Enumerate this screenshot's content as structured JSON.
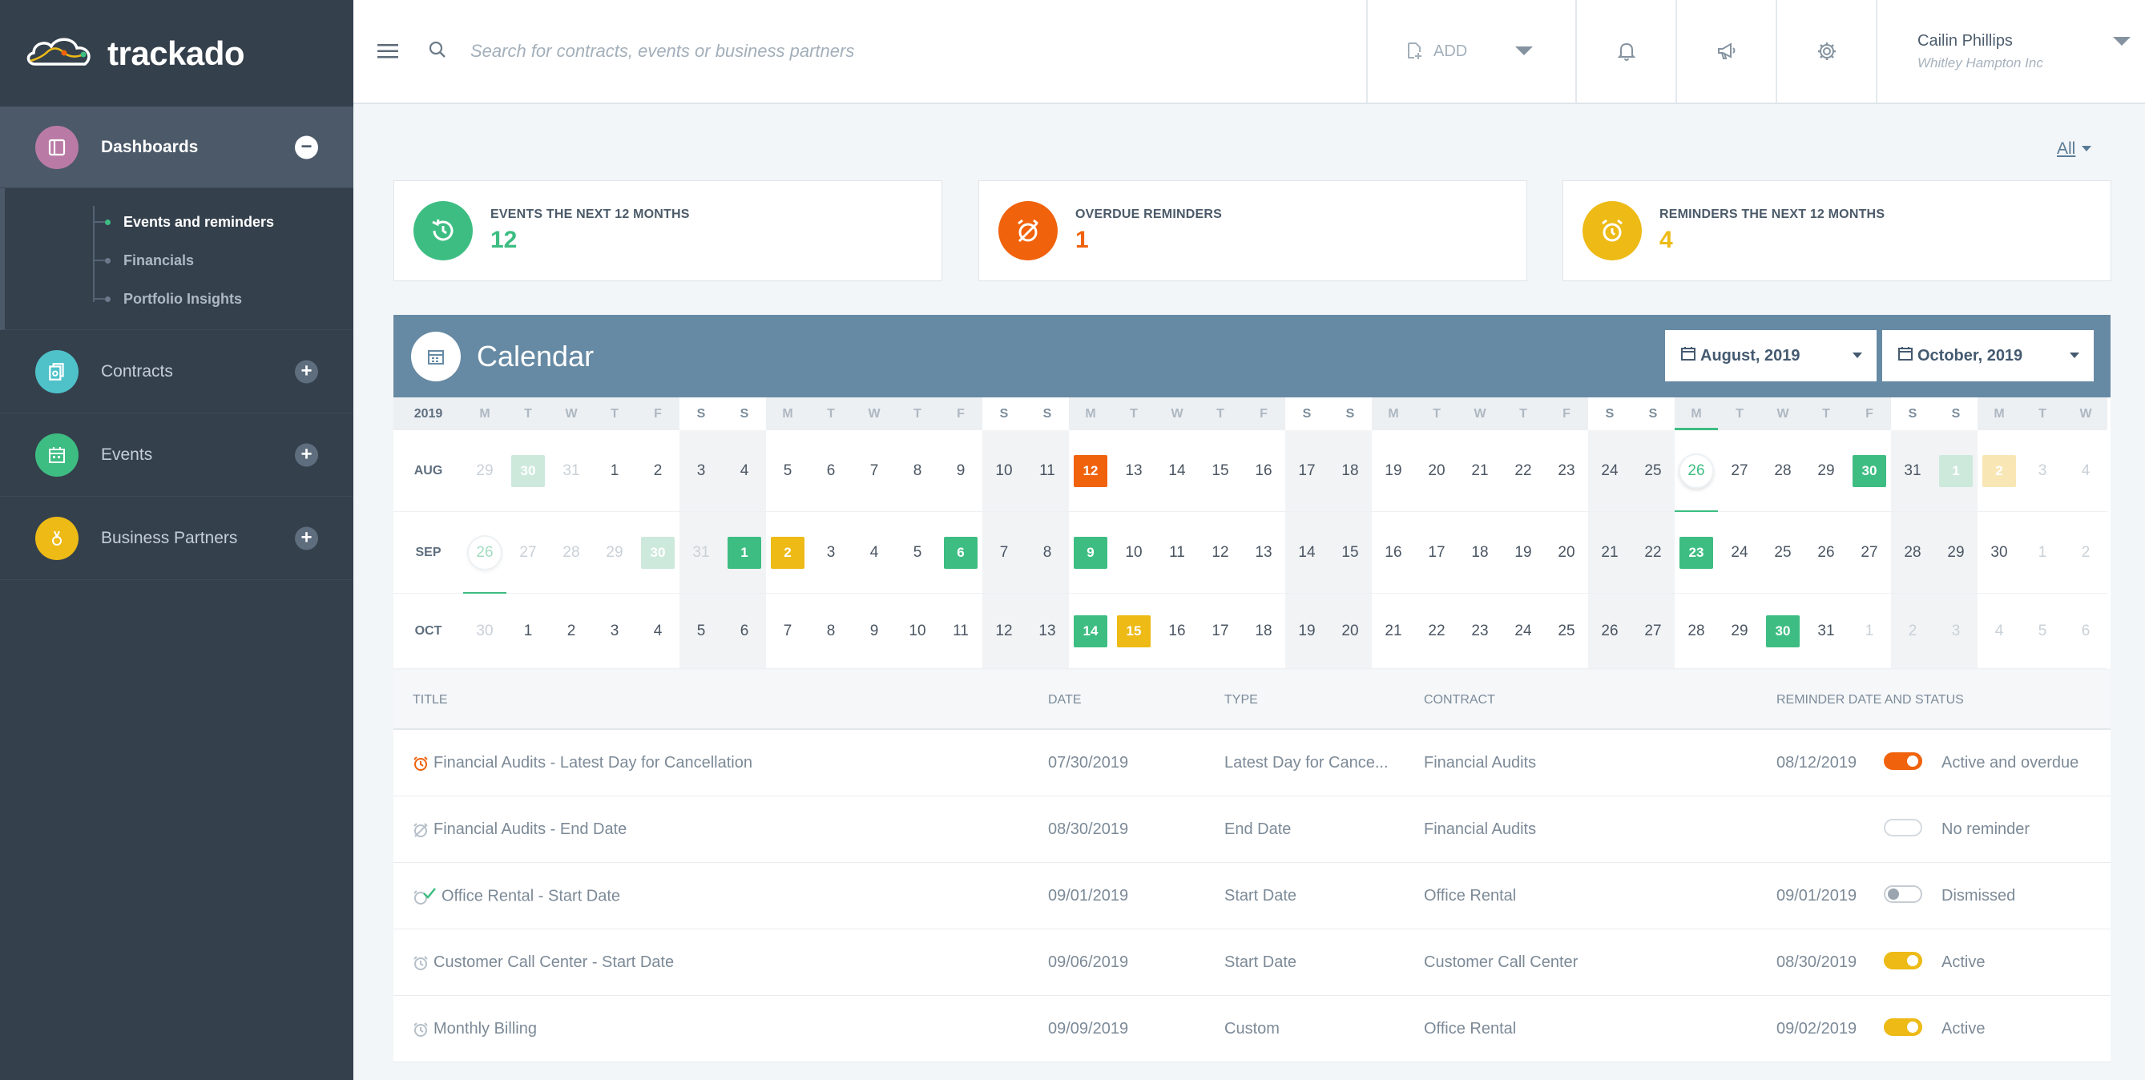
{
  "brand": {
    "name": "trackado"
  },
  "sidebar": {
    "items": [
      {
        "label": "Dashboards",
        "icon": "dashboard-icon",
        "color": "#b97ba5",
        "toggle": "−"
      },
      {
        "label": "Contracts",
        "icon": "contracts-icon",
        "color": "#4fc1c9",
        "toggle": "+"
      },
      {
        "label": "Events",
        "icon": "events-icon",
        "color": "#3dbd82",
        "toggle": "+"
      },
      {
        "label": "Business Partners",
        "icon": "partners-icon",
        "color": "#edba16",
        "toggle": "+"
      }
    ],
    "subitems": [
      "Events and reminders",
      "Financials",
      "Portfolio Insights"
    ]
  },
  "topbar": {
    "search_placeholder": "Search for contracts, events or business partners",
    "add_label": "ADD",
    "user_name": "Cailin Phillips",
    "user_org": "Whitley Hampton Inc"
  },
  "filter": {
    "label": "All"
  },
  "stats": [
    {
      "title": "EVENTS THE NEXT 12 MONTHS",
      "value": "12",
      "color": "#3dbd82",
      "icon": "history-icon"
    },
    {
      "title": "OVERDUE REMINDERS",
      "value": "1",
      "color": "#f0620c",
      "icon": "alarm-off-icon"
    },
    {
      "title": "REMINDERS THE NEXT 12 MONTHS",
      "value": "4",
      "color": "#edba16",
      "icon": "alarm-clock-icon"
    }
  ],
  "calendar": {
    "title": "Calendar",
    "from": "August, 2019",
    "to": "October, 2019",
    "year": "2019",
    "weekdays": [
      "M",
      "T",
      "W",
      "T",
      "F",
      "S",
      "S",
      "M",
      "T",
      "W",
      "T",
      "F",
      "S",
      "S",
      "M",
      "T",
      "W",
      "T",
      "F",
      "S",
      "S",
      "M",
      "T",
      "W",
      "T",
      "F",
      "S",
      "S",
      "M",
      "T",
      "W",
      "T",
      "F",
      "S",
      "S",
      "M",
      "T",
      "W"
    ],
    "rows": [
      {
        "month": "AUG",
        "days": [
          "29",
          "30",
          "31",
          "1",
          "2",
          "3",
          "4",
          "5",
          "6",
          "7",
          "8",
          "9",
          "10",
          "11",
          "12",
          "13",
          "14",
          "15",
          "16",
          "17",
          "18",
          "19",
          "20",
          "21",
          "22",
          "23",
          "24",
          "25",
          "26",
          "27",
          "28",
          "29",
          "30",
          "31",
          "1",
          "2",
          "3",
          "4"
        ]
      },
      {
        "month": "SEP",
        "days": [
          "26",
          "27",
          "28",
          "29",
          "30",
          "31",
          "1",
          "2",
          "3",
          "4",
          "5",
          "6",
          "7",
          "8",
          "9",
          "10",
          "11",
          "12",
          "13",
          "14",
          "15",
          "16",
          "17",
          "18",
          "19",
          "20",
          "21",
          "22",
          "23",
          "24",
          "25",
          "26",
          "27",
          "28",
          "29",
          "30",
          "1",
          "2"
        ]
      },
      {
        "month": "OCT",
        "days": [
          "30",
          "1",
          "2",
          "3",
          "4",
          "5",
          "6",
          "7",
          "8",
          "9",
          "10",
          "11",
          "12",
          "13",
          "14",
          "15",
          "16",
          "17",
          "18",
          "19",
          "20",
          "21",
          "22",
          "23",
          "24",
          "25",
          "26",
          "27",
          "28",
          "29",
          "30",
          "31",
          "1",
          "2",
          "3",
          "4",
          "5",
          "6"
        ]
      }
    ]
  },
  "table": {
    "headers": {
      "title": "TITLE",
      "date": "DATE",
      "type": "TYPE",
      "contract": "CONTRACT",
      "reminder": "REMINDER DATE AND STATUS"
    },
    "rows": [
      {
        "title": "Financial Audits - Latest Day for Cancellation",
        "date": "07/30/2019",
        "type": "Latest Day for Cance...",
        "contract": "Financial Audits",
        "reminder_date": "08/12/2019",
        "status": "Active and overdue"
      },
      {
        "title": "Financial Audits - End Date",
        "date": "08/30/2019",
        "type": "End Date",
        "contract": "Financial Audits",
        "reminder_date": "",
        "status": "No reminder"
      },
      {
        "title": "Office Rental - Start Date",
        "date": "09/01/2019",
        "type": "Start Date",
        "contract": "Office Rental",
        "reminder_date": "09/01/2019",
        "status": "Dismissed"
      },
      {
        "title": "Customer Call Center - Start Date",
        "date": "09/06/2019",
        "type": "Start Date",
        "contract": "Customer Call Center",
        "reminder_date": "08/30/2019",
        "status": "Active"
      },
      {
        "title": "Monthly Billing",
        "date": "09/09/2019",
        "type": "Custom",
        "contract": "Office Rental",
        "reminder_date": "09/02/2019",
        "status": "Active"
      }
    ]
  }
}
